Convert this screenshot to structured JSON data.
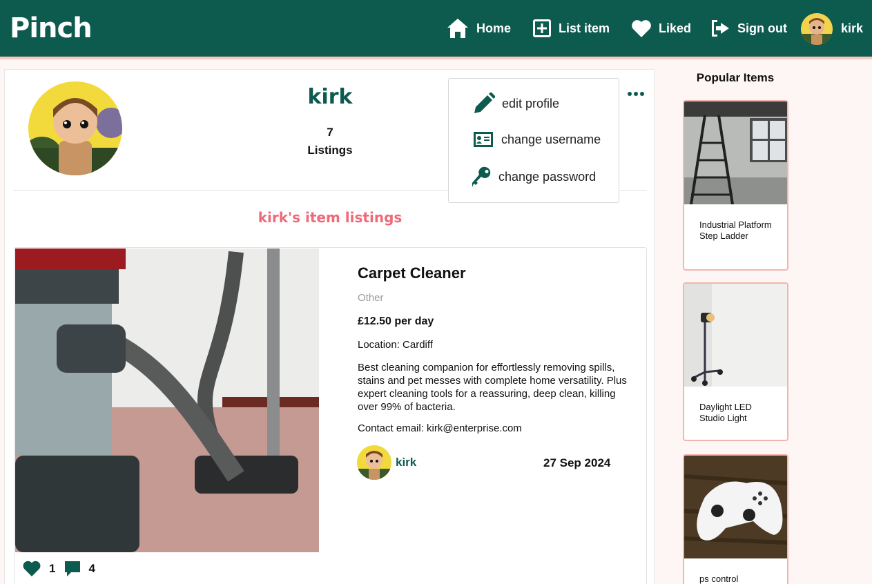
{
  "nav": {
    "brand": "Pinch",
    "items": [
      {
        "label": "Home",
        "icon": "home-icon"
      },
      {
        "label": "List item",
        "icon": "plus-square-icon"
      },
      {
        "label": "Liked",
        "icon": "heart-icon"
      },
      {
        "label": "Sign out",
        "icon": "sign-out-icon"
      }
    ],
    "username": "kirk"
  },
  "profile": {
    "name": "kirk",
    "listing_count": "7",
    "listing_label": "Listings",
    "section_title": "kirk's item listings"
  },
  "menu": {
    "items": [
      {
        "label": "edit profile",
        "icon": "pencil-icon"
      },
      {
        "label": "change username",
        "icon": "id-card-icon"
      },
      {
        "label": "change password",
        "icon": "key-icon"
      }
    ]
  },
  "listing": {
    "title": "Carpet Cleaner",
    "category": "Other",
    "price": "£12.50 per day",
    "location": "Location: Cardiff",
    "description": "Best cleaning companion for effortlessly removing spills, stains and pet messes with complete home versatility. Plus expert cleaning tools for a reassuring, deep clean, killing over 99% of bacteria.",
    "contact": "Contact email: kirk@enterprise.com",
    "owner": "kirk",
    "date": "27 Sep 2024",
    "likes": "1",
    "comments": "4"
  },
  "sidebar": {
    "title": "Popular Items",
    "items": [
      {
        "name": "Industrial Platform Step Ladder"
      },
      {
        "name": "Daylight LED Studio Light"
      },
      {
        "name": "ps control"
      }
    ]
  },
  "colors": {
    "brand": "#0d5a4f",
    "accent_pink": "#ee6a78",
    "card_border": "#f3b5ad"
  }
}
